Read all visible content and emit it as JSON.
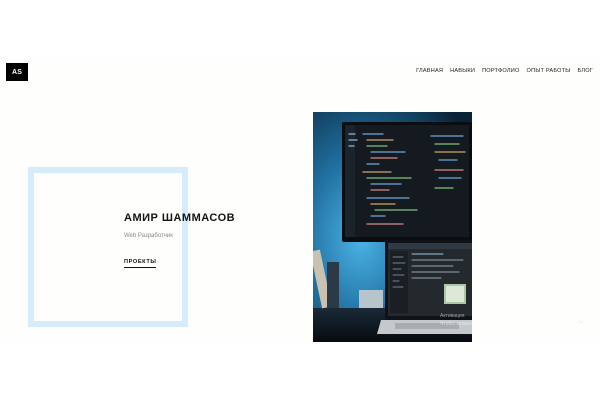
{
  "logo": {
    "text": "AS"
  },
  "nav": {
    "items": [
      {
        "label": "ГЛАВНАЯ"
      },
      {
        "label": "НАВЫКИ"
      },
      {
        "label": "ПОРТФОЛИО"
      },
      {
        "label": "ОПЫТ РАБОТЫ"
      },
      {
        "label": "БЛОГ"
      }
    ]
  },
  "hero": {
    "name": "АМИР ШАММАСОВ",
    "role": "Web Разработчик",
    "cta_label": "ПРОЕКТЫ"
  },
  "image": {
    "overlay_line1": "Активация",
    "overlay_line2": "Чтобы активир"
  },
  "colors": {
    "frame": "#d6ebfb",
    "logo_bg": "#000000",
    "photo_glow": "#3aa0d8"
  },
  "icons": {
    "scroll": "chevron-down-icon"
  }
}
